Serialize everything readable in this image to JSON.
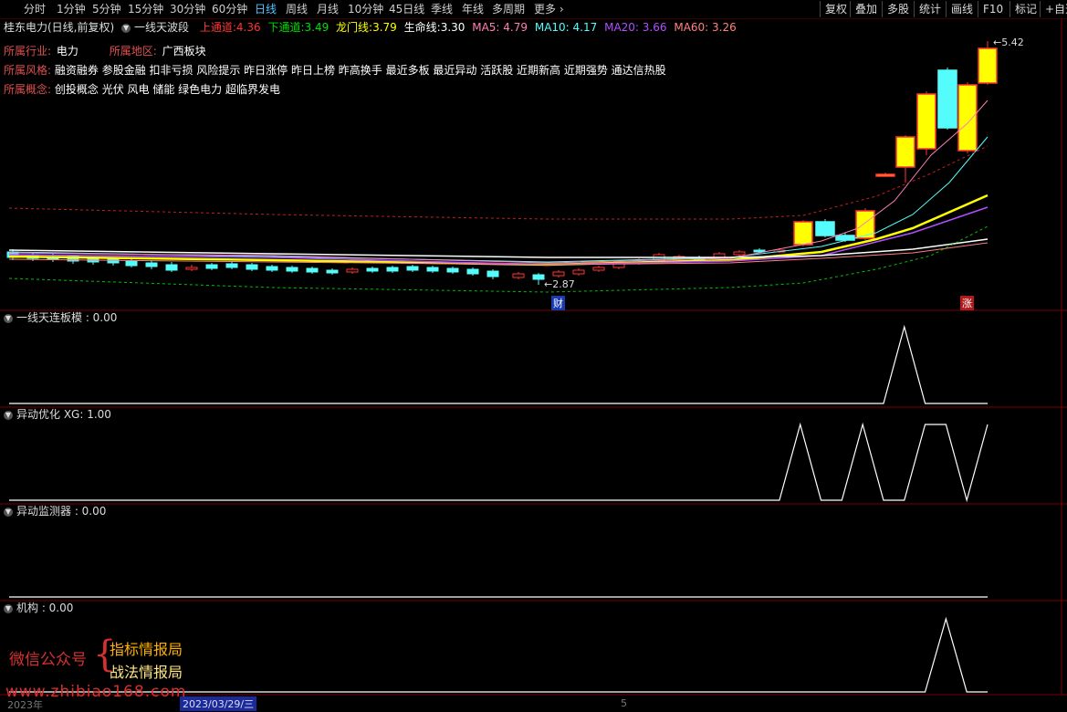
{
  "toolbar": {
    "timeframes": [
      "分时",
      "1分钟",
      "5分钟",
      "15分钟",
      "30分钟",
      "60分钟",
      "日线",
      "周线",
      "月线",
      "10分钟",
      "45日线",
      "季线",
      "年线",
      "多周期",
      "更多"
    ],
    "active": "日线",
    "more_icon": "chevron-right-icon",
    "buttons": [
      "复权",
      "叠加",
      "多股",
      "统计",
      "画线",
      "F10",
      "标记",
      "+自选"
    ]
  },
  "info": {
    "stock": "桂东电力(日线,前复权)",
    "indicator": "一线天波段",
    "upper_label": "上通道:",
    "upper_value": "4.36",
    "lower_label": "下通道:",
    "lower_value": "3.49",
    "dragon_label": "龙门线:",
    "dragon_value": "3.79",
    "life_label": "生命线:",
    "life_value": "3.30",
    "ma5": "MA5: 4.79",
    "ma10": "MA10: 4.17",
    "ma20": "MA20: 3.66",
    "ma60": "MA60: 3.26"
  },
  "tags": {
    "industry_label": "所属行业:",
    "industry": "电力",
    "region_label": "所属地区:",
    "region": "广西板块",
    "style_label": "所属风格:",
    "style": "融资融券 参股金融 扣非亏损 风险提示 昨日涨停 昨日上榜 昨高换手 最近多板 最近异动 活跃股 近期新高 近期强势 通达信热股",
    "concept_label": "所属概念:",
    "concept": "创投概念 光伏 风电 储能 绿色电力 超临界发电"
  },
  "chart_labels": {
    "high": "5.42",
    "low": "2.87",
    "cai": "财",
    "zhang": "涨"
  },
  "panels": [
    {
      "title": "一线天连板模 : 0.00"
    },
    {
      "title": "异动优化 XG: 1.00"
    },
    {
      "title": "异动监测器 : 0.00"
    },
    {
      "title": "机构 : 0.00"
    }
  ],
  "watermark": {
    "line1": "微信公众号",
    "line2": "指标情报局",
    "line3": "战法情报局",
    "url": "www.zhibiao168.com"
  },
  "dates": {
    "left": "2023年",
    "mid": "2023/03/29/三",
    "right": "5"
  },
  "colors": {
    "up": "#ff3232",
    "down": "#54fcfc",
    "accent": "#4fc3ff",
    "highlight": "#ffff00"
  },
  "chart_data": [
    {
      "type": "line",
      "title": "一线天连板模",
      "x": [
        0,
        1,
        2,
        3,
        4,
        5,
        6,
        7,
        8,
        9,
        10,
        11,
        12,
        13,
        14,
        15,
        16,
        17,
        18,
        19,
        20,
        21,
        22,
        23,
        24,
        25,
        26,
        27,
        28,
        29,
        30,
        31,
        32,
        33,
        34,
        35,
        36,
        37,
        38,
        39,
        40,
        41,
        42,
        43,
        44,
        45,
        46,
        47
      ],
      "values": [
        0,
        0,
        0,
        0,
        0,
        0,
        0,
        0,
        0,
        0,
        0,
        0,
        0,
        0,
        0,
        0,
        0,
        0,
        0,
        0,
        0,
        0,
        0,
        0,
        0,
        0,
        0,
        0,
        0,
        0,
        0,
        0,
        0,
        0,
        0,
        0,
        0,
        0,
        0,
        0,
        0,
        0,
        0,
        1,
        0,
        0,
        0,
        0
      ]
    },
    {
      "type": "line",
      "title": "异动优化",
      "x": [
        0,
        1,
        2,
        3,
        4,
        5,
        6,
        7,
        8,
        9,
        10,
        11,
        12,
        13,
        14,
        15,
        16,
        17,
        18,
        19,
        20,
        21,
        22,
        23,
        24,
        25,
        26,
        27,
        28,
        29,
        30,
        31,
        32,
        33,
        34,
        35,
        36,
        37,
        38,
        39,
        40,
        41,
        42,
        43,
        44,
        45,
        46,
        47
      ],
      "values": [
        0,
        0,
        0,
        0,
        0,
        0,
        0,
        0,
        0,
        0,
        0,
        0,
        0,
        0,
        0,
        0,
        0,
        0,
        0,
        0,
        0,
        0,
        0,
        0,
        0,
        0,
        0,
        0,
        0,
        0,
        0,
        0,
        0,
        0,
        0,
        0,
        0,
        0,
        1,
        0,
        0,
        1,
        0,
        0,
        1,
        1,
        0,
        1
      ]
    },
    {
      "type": "line",
      "title": "机构",
      "x": [
        0,
        1,
        2,
        3,
        4,
        5,
        6,
        7,
        8,
        9,
        10,
        11,
        12,
        13,
        14,
        15,
        16,
        17,
        18,
        19,
        20,
        21,
        22,
        23,
        24,
        25,
        26,
        27,
        28,
        29,
        30,
        31,
        32,
        33,
        34,
        35,
        36,
        37,
        38,
        39,
        40,
        41,
        42,
        43,
        44,
        45,
        46,
        47
      ],
      "values": [
        0,
        0,
        0,
        0,
        0,
        0,
        0,
        0,
        0,
        0,
        0,
        0,
        0,
        0,
        0,
        0,
        0,
        0,
        0,
        0,
        0,
        0,
        0,
        0,
        0,
        0,
        0,
        0,
        0,
        0,
        0,
        0,
        0,
        0,
        0,
        0,
        0,
        0,
        0,
        0,
        0,
        0,
        0,
        0,
        0,
        1,
        0,
        0
      ]
    }
  ]
}
